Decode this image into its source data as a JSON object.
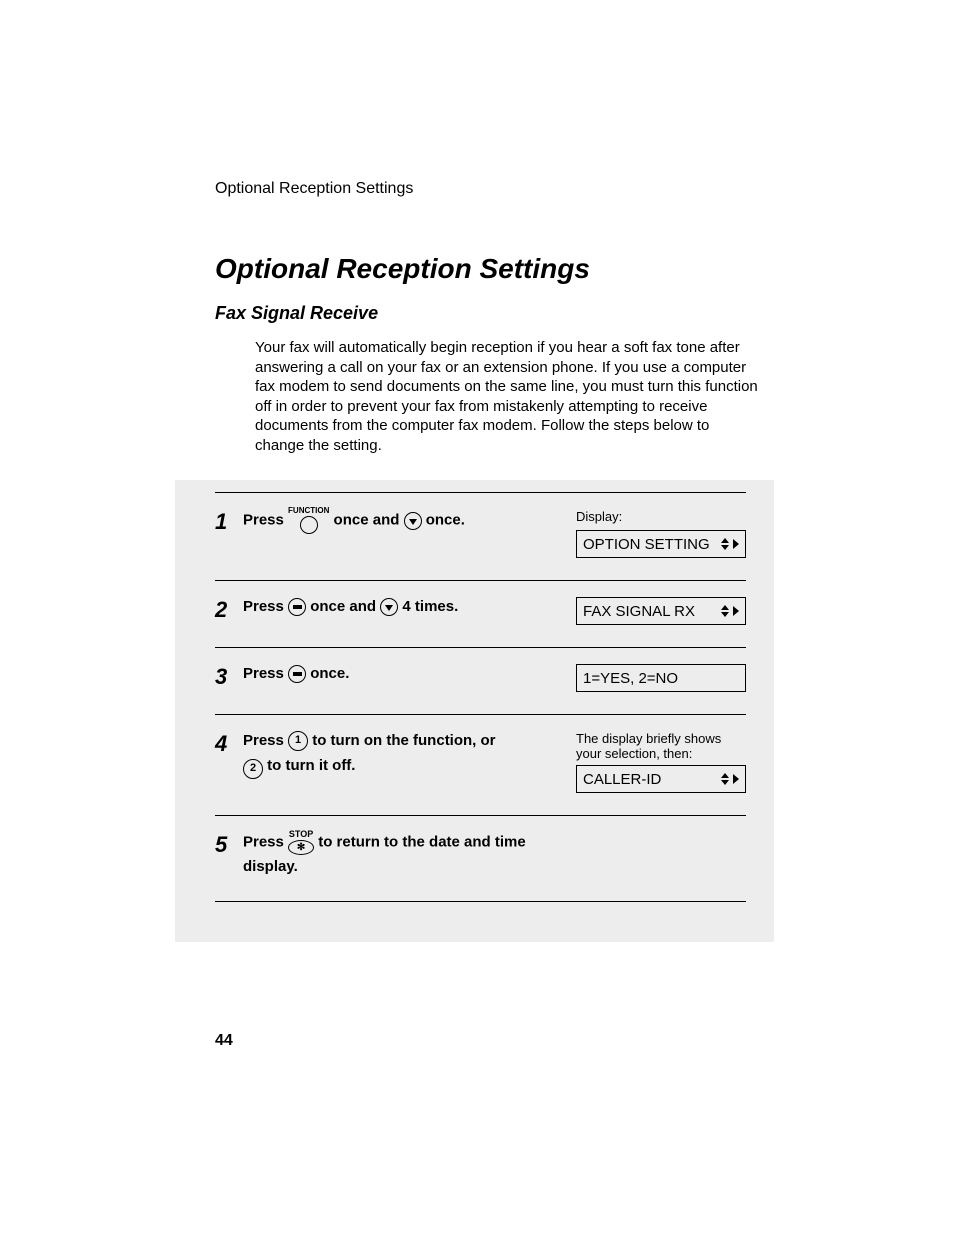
{
  "running_header": "Optional Reception Settings",
  "main_title": "Optional Reception Settings",
  "sub_title": "Fax Signal Receive",
  "intro": "Your fax will automatically begin reception if you hear a soft fax tone after answering a call on your fax or an extension phone. If you use a computer fax modem to send documents on the same line, you must turn this function off in order to prevent your fax from mistakenly attempting to receive documents from the computer fax modem. Follow the steps below to change the setting.",
  "display_label": "Display:",
  "steps": [
    {
      "num": "1",
      "press": "Press",
      "func_label": "FUNCTION",
      "mid1": " once and ",
      "end": " once.",
      "lcd": "OPTION SETTING",
      "lcd_arrows": true
    },
    {
      "num": "2",
      "press": "Press",
      "mid1": " once and ",
      "end": " 4 times.",
      "lcd": "FAX SIGNAL RX",
      "lcd_arrows": true
    },
    {
      "num": "3",
      "press": "Press",
      "end": " once.",
      "lcd": "1=YES, 2=NO",
      "lcd_arrows": false
    },
    {
      "num": "4",
      "press": "Press",
      "key1": "1",
      "mid1": " to turn on the function, or",
      "key2": "2",
      "end": " to turn it off.",
      "note": "The display briefly shows your selection, then:",
      "lcd": "CALLER-ID",
      "lcd_arrows": true
    },
    {
      "num": "5",
      "press": "Press",
      "stop_label": "STOP",
      "end": " to return to the date and time display."
    }
  ],
  "page_number": "44"
}
